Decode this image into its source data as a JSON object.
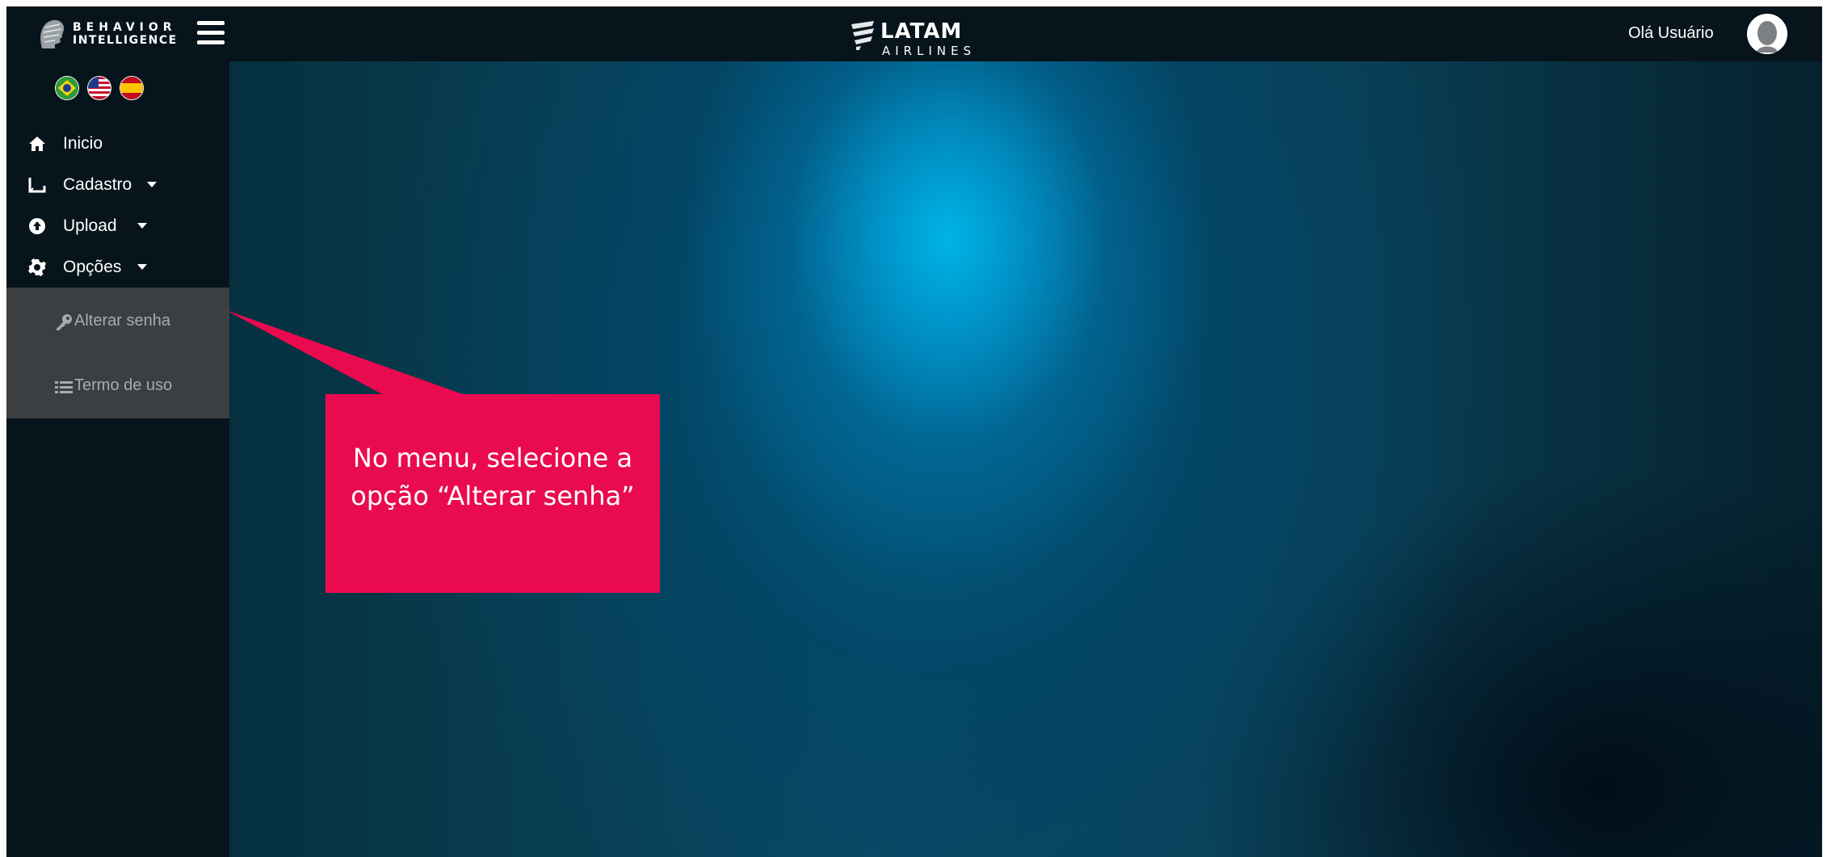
{
  "brand": {
    "left_logo_line1": "BEHAVIOR",
    "left_logo_line2": "INTELLIGENCE",
    "center_logo_name": "LATAM",
    "center_logo_sub": "AIRLINES"
  },
  "header": {
    "greeting": "Olá Usuário",
    "menu_icon": "hamburger-icon",
    "avatar_icon": "user-avatar-icon"
  },
  "languages": [
    {
      "icon": "brazil-flag-icon"
    },
    {
      "icon": "usa-flag-icon"
    },
    {
      "icon": "spain-flag-icon"
    }
  ],
  "sidebar": {
    "items": [
      {
        "label": "Inicio",
        "icon": "home-icon",
        "has_caret": false
      },
      {
        "label": "Cadastro",
        "icon": "book-icon",
        "has_caret": true
      },
      {
        "label": "Upload",
        "icon": "upload-icon",
        "has_caret": true
      },
      {
        "label": "Opções",
        "icon": "gear-icon",
        "has_caret": true
      }
    ],
    "submenu": [
      {
        "label": "Alterar senha",
        "icon": "key-icon"
      },
      {
        "label": "Termo de uso",
        "icon": "list-icon"
      }
    ]
  },
  "callout": {
    "text": "No menu, selecione a opção “Alterar senha”"
  },
  "colors": {
    "sidebar_bg": "#07141b",
    "submenu_bg": "#3b3f41",
    "callout_bg": "#ea0a50",
    "accent_blue": "#00b4e6"
  }
}
